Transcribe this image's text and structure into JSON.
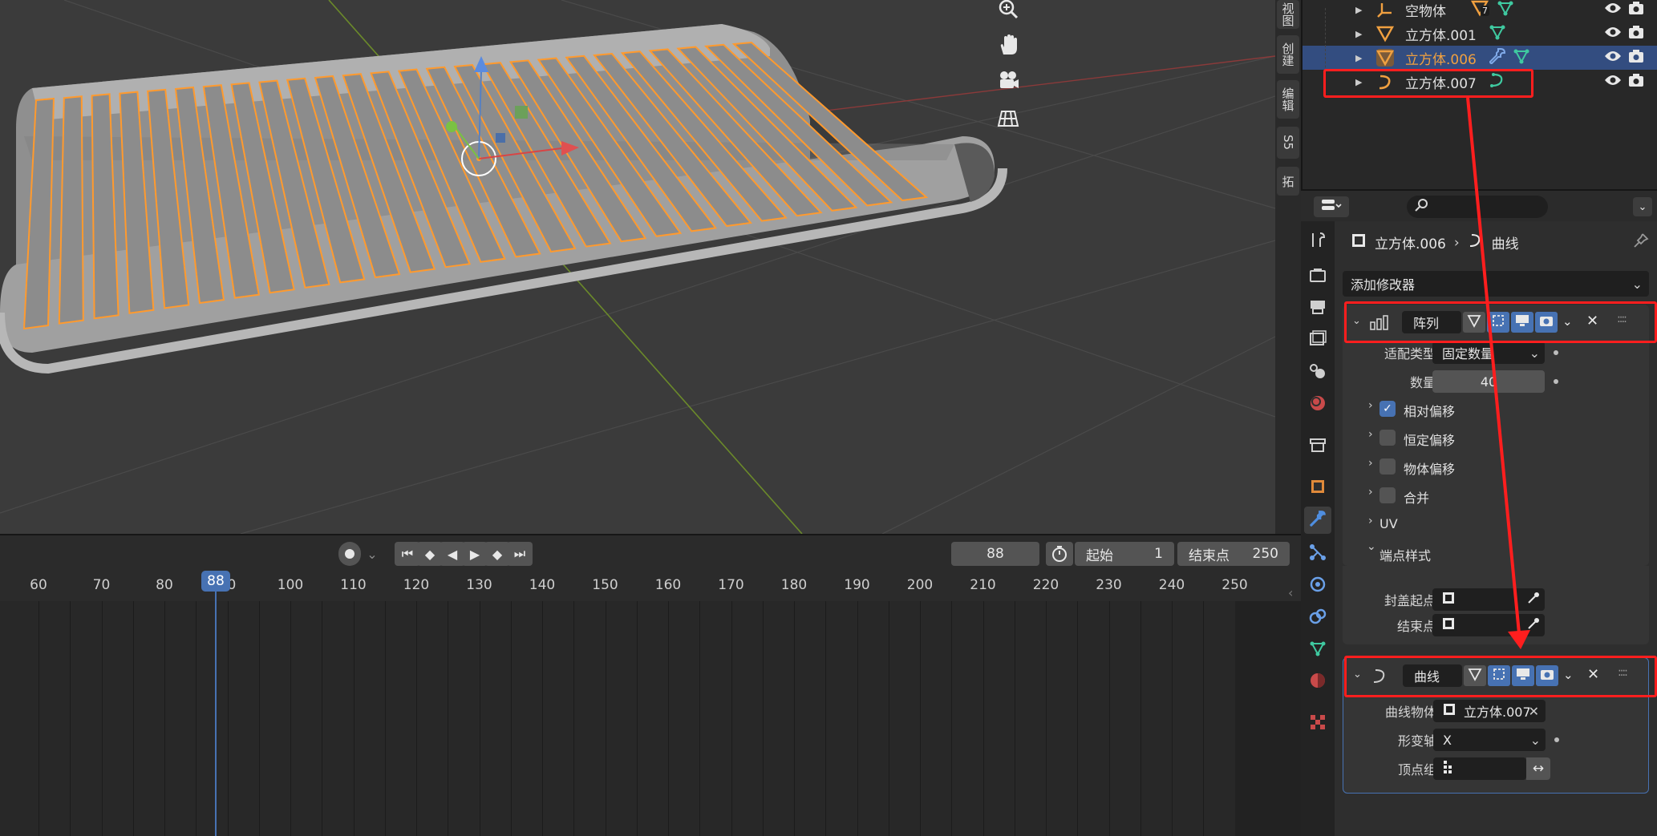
{
  "viewport": {
    "gizmos": [
      "zoom-icon",
      "pan-hand-icon",
      "camera-icon",
      "grid-icon"
    ]
  },
  "side_tabs": [
    "视图",
    "创建",
    "编辑",
    "S5",
    "拓"
  ],
  "timeline": {
    "current_frame": "88",
    "start_label": "起始",
    "start_value": "1",
    "end_label": "结束点",
    "end_value": "250",
    "ticks": [
      "60",
      "70",
      "80",
      "90",
      "100",
      "110",
      "120",
      "130",
      "140",
      "150",
      "160",
      "170",
      "180",
      "190",
      "200",
      "210",
      "220",
      "230",
      "240",
      "250"
    ],
    "playhead": "88"
  },
  "outliner": {
    "rows": [
      {
        "name": "空物体",
        "badge": "7",
        "type": "empty",
        "selected": false
      },
      {
        "name": "立方体.001",
        "type": "mesh",
        "selected": false
      },
      {
        "name": "立方体.006",
        "type": "mesh",
        "selected": true
      },
      {
        "name": "立方体.007",
        "type": "curve",
        "selected": false
      }
    ]
  },
  "properties": {
    "search_placeholder": "",
    "breadcrumb_object": "立方体.006",
    "breadcrumb_data": "曲线",
    "add_modifier": "添加修改器",
    "array": {
      "name": "阵列",
      "fit_type_label": "适配类型",
      "fit_type_value": "固定数量",
      "count_label": "数量",
      "count_value": "40",
      "relative_offset": "相对偏移",
      "constant_offset": "恒定偏移",
      "object_offset": "物体偏移",
      "merge": "合并",
      "uv": "UV",
      "caps": "端点样式",
      "cap_start": "封盖起点",
      "cap_end": "结束点"
    },
    "curve": {
      "name": "曲线",
      "curve_object_label": "曲线物体",
      "curve_object_value": "立方体.007",
      "deform_axis_label": "形变轴",
      "deform_axis_value": "X",
      "vertex_group_label": "顶点组"
    }
  },
  "colors": {
    "selection": "#4772b3",
    "outline_orange": "#ff9a2e",
    "annotation_red": "#ff1e1e"
  }
}
